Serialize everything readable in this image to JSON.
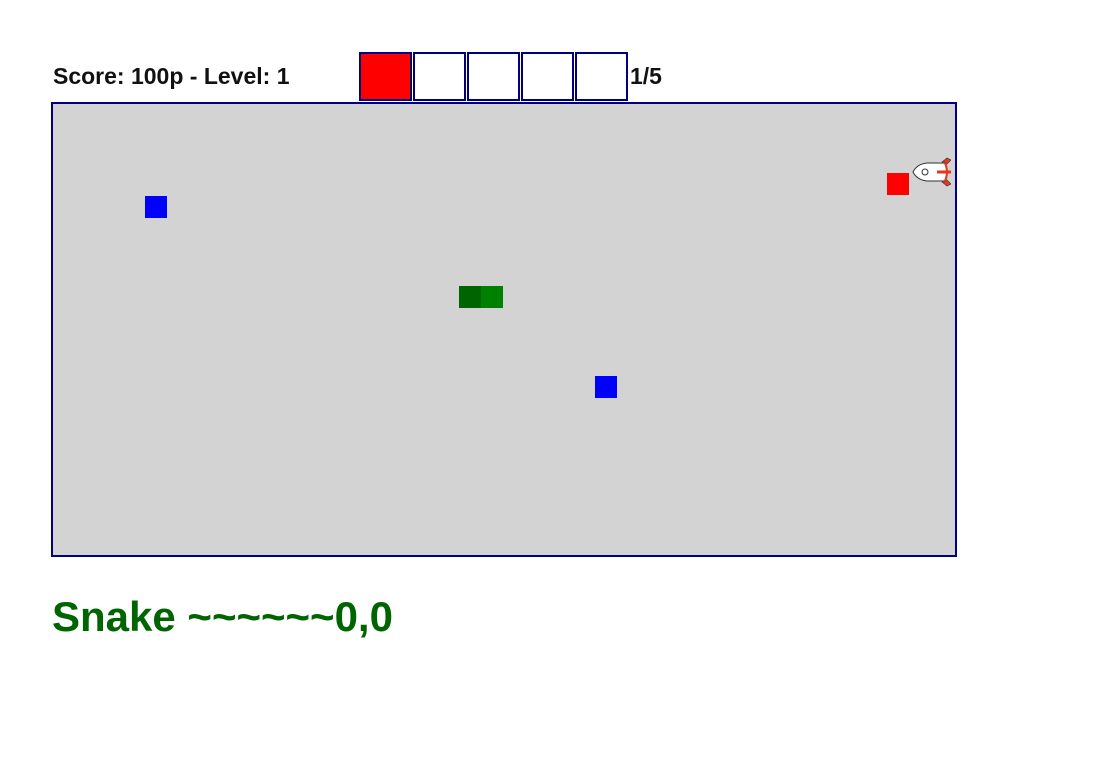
{
  "hud": {
    "score_text": "Score: 100p - Level: 1",
    "progress_text": "1/5",
    "level_boxes": [
      {
        "state": "filled",
        "color": "#ff0000"
      },
      {
        "state": "empty"
      },
      {
        "state": "empty"
      },
      {
        "state": "empty"
      },
      {
        "state": "empty"
      }
    ]
  },
  "board": {
    "background": "#d3d3d3",
    "border_color": "#00007f",
    "pieces": {
      "food_color": "#0000ff",
      "enemy_color": "#ff0000",
      "snake_head_color": "#006400",
      "snake_body_color": "#008000",
      "rocket_icon": "rocket-icon"
    }
  },
  "caption": {
    "text": "Snake ~~~~~~0,0",
    "color": "#006400"
  }
}
